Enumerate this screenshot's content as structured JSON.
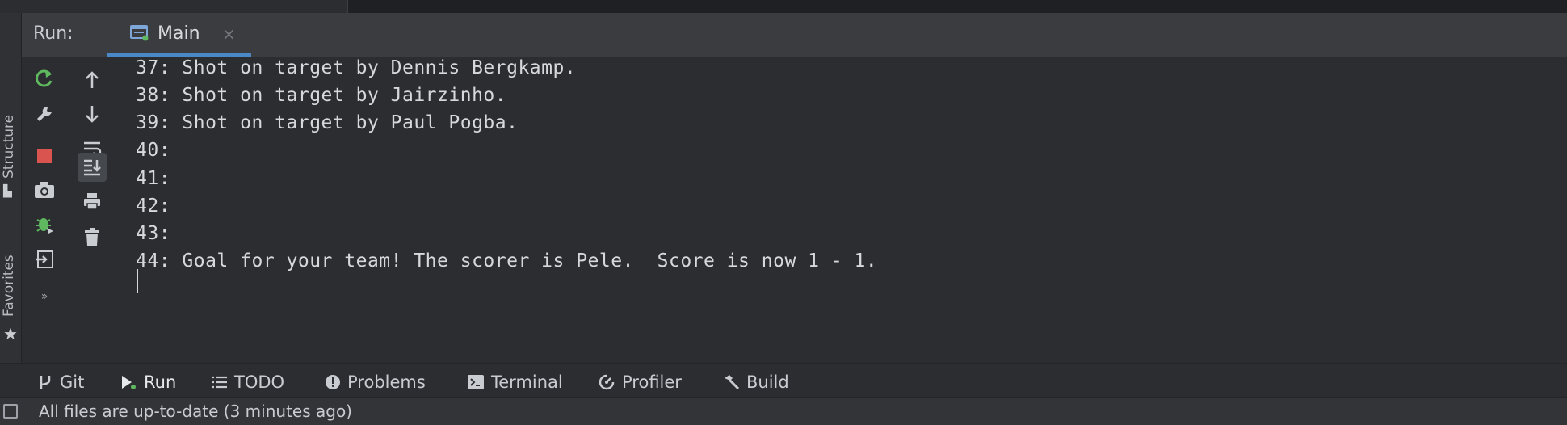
{
  "run_panel": {
    "label": "Run:",
    "tab": {
      "label": "Main",
      "close": "×"
    }
  },
  "left_strip": {
    "structure_label": "Structure",
    "favorites_label": "Favorites",
    "more": "»"
  },
  "console": {
    "lines": [
      "37: Shot on target by Dennis Bergkamp.",
      "38: Shot on target by Jairzinho.",
      "39: Shot on target by Paul Pogba.",
      "40:",
      "41:",
      "42:",
      "43:",
      "44: Goal for your team! The scorer is Pele.  Score is now 1 - 1."
    ]
  },
  "tool_windows": [
    {
      "label": "Git",
      "icon": "git-branch-icon"
    },
    {
      "label": "Run",
      "icon": "run-icon",
      "selected": true
    },
    {
      "label": "TODO",
      "icon": "list-icon"
    },
    {
      "label": "Problems",
      "icon": "problems-icon"
    },
    {
      "label": "Terminal",
      "icon": "terminal-icon"
    },
    {
      "label": "Profiler",
      "icon": "profiler-icon"
    },
    {
      "label": "Build",
      "icon": "hammer-icon"
    }
  ],
  "status_bar": {
    "text": "All files are up-to-date (3 minutes ago)"
  },
  "colors": {
    "accent_underline": "#4a88c7",
    "rerun_green": "#5fb85f",
    "stop_red": "#d9534f",
    "console_text": "#d6d8dc"
  }
}
